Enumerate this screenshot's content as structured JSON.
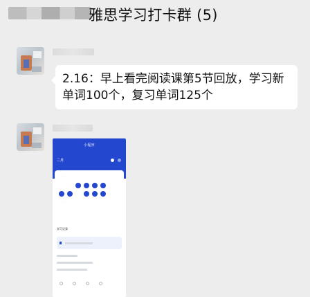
{
  "chat": {
    "title": "雅思学习打卡群 (5)"
  },
  "messages": [
    {
      "type": "text",
      "lines": [
        "2.16：早上看完阅读课第5节回放，学习新",
        "单词100个，复习单词125个"
      ]
    },
    {
      "type": "image",
      "screenshot": {
        "app_title": "小程序",
        "section_label": "二月",
        "list_label": "学习记录"
      }
    }
  ],
  "colors": {
    "background": "#ededed",
    "bubble": "#ffffff",
    "accent_blue": "#2447d0"
  }
}
